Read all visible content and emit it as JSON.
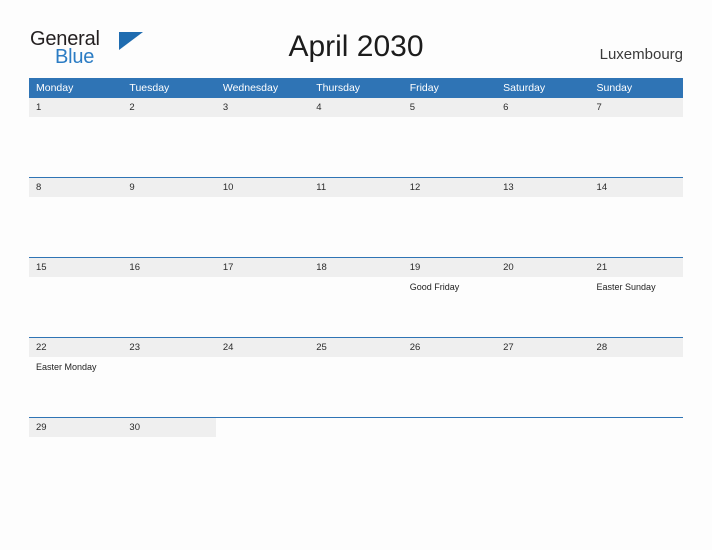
{
  "brand": {
    "name_part1": "General",
    "name_part2": "Blue"
  },
  "header": {
    "title": "April 2030",
    "country": "Luxembourg"
  },
  "colors": {
    "header_blue": "#2f74b5",
    "brand_blue": "#2b7cc4",
    "daynum_band": "#efefef",
    "page_background": "#fdfdfd"
  },
  "calendar": {
    "weekday_headers": [
      "Monday",
      "Tuesday",
      "Wednesday",
      "Thursday",
      "Friday",
      "Saturday",
      "Sunday"
    ],
    "weeks": [
      {
        "days": [
          {
            "number": "1",
            "events": []
          },
          {
            "number": "2",
            "events": []
          },
          {
            "number": "3",
            "events": []
          },
          {
            "number": "4",
            "events": []
          },
          {
            "number": "5",
            "events": []
          },
          {
            "number": "6",
            "events": []
          },
          {
            "number": "7",
            "events": []
          }
        ]
      },
      {
        "days": [
          {
            "number": "8",
            "events": []
          },
          {
            "number": "9",
            "events": []
          },
          {
            "number": "10",
            "events": []
          },
          {
            "number": "11",
            "events": []
          },
          {
            "number": "12",
            "events": []
          },
          {
            "number": "13",
            "events": []
          },
          {
            "number": "14",
            "events": []
          }
        ]
      },
      {
        "days": [
          {
            "number": "15",
            "events": []
          },
          {
            "number": "16",
            "events": []
          },
          {
            "number": "17",
            "events": []
          },
          {
            "number": "18",
            "events": []
          },
          {
            "number": "19",
            "events": [
              "Good Friday"
            ]
          },
          {
            "number": "20",
            "events": []
          },
          {
            "number": "21",
            "events": [
              "Easter Sunday"
            ]
          }
        ]
      },
      {
        "days": [
          {
            "number": "22",
            "events": [
              "Easter Monday"
            ]
          },
          {
            "number": "23",
            "events": []
          },
          {
            "number": "24",
            "events": []
          },
          {
            "number": "25",
            "events": []
          },
          {
            "number": "26",
            "events": []
          },
          {
            "number": "27",
            "events": []
          },
          {
            "number": "28",
            "events": []
          }
        ]
      },
      {
        "short": true,
        "days": [
          {
            "number": "29",
            "events": []
          },
          {
            "number": "30",
            "events": []
          },
          {
            "number": "",
            "events": []
          },
          {
            "number": "",
            "events": []
          },
          {
            "number": "",
            "events": []
          },
          {
            "number": "",
            "events": []
          },
          {
            "number": "",
            "events": []
          }
        ]
      }
    ]
  }
}
